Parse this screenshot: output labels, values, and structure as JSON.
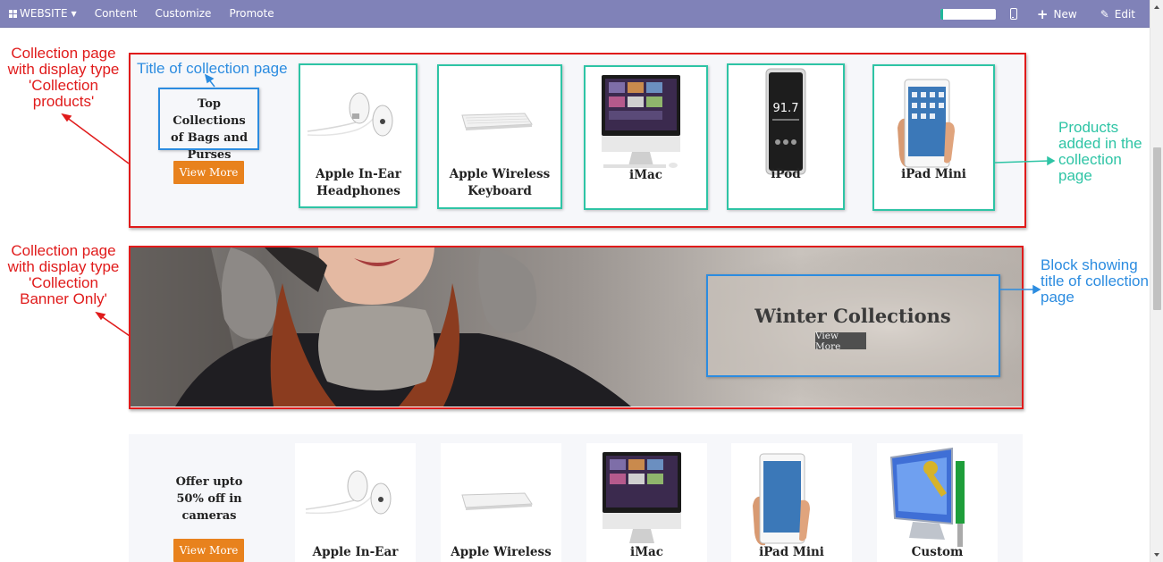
{
  "topbar": {
    "website_label": "WEBSITE",
    "menu": [
      "Content",
      "Customize",
      "Promote"
    ],
    "progress_fraction": 0.05,
    "new_label": "New",
    "edit_label": "Edit"
  },
  "colors": {
    "topbar": "#8082b8",
    "accent_button": "#e8821d",
    "annotation_red": "#e01b1b",
    "annotation_blue": "#2c8ce0",
    "annotation_green": "#2ec4a5"
  },
  "annotations": {
    "collection_products": "Collection page\nwith display type\n'Collection\nproducts'",
    "title_of_collection": "Title of collection page",
    "products_added": "Products\nadded in the\ncollection\npage",
    "collection_banner": "Collection page\nwith display type\n'Collection\nBanner Only'",
    "block_title": "Block showing\ntitle of collection\npage"
  },
  "collection_1": {
    "title": "Top Collections\nof Bags and\nPurses",
    "button": "View More",
    "products": [
      {
        "name": "Apple In-Ear\nHeadphones",
        "icon": "earphones-image"
      },
      {
        "name": "Apple Wireless\nKeyboard",
        "icon": "keyboard-image"
      },
      {
        "name": "iMac",
        "icon": "imac-image"
      },
      {
        "name": "iPod",
        "icon": "ipod-image"
      },
      {
        "name": "iPad Mini",
        "icon": "ipad-image"
      }
    ]
  },
  "banner": {
    "title": "Winter Collections",
    "button": "View More"
  },
  "collection_3": {
    "title": "Offer upto\n50% off in\ncameras",
    "button": "View More",
    "products": [
      {
        "name": "Apple In-Ear",
        "icon": "earphones-image"
      },
      {
        "name": "Apple Wireless",
        "icon": "keyboard-image"
      },
      {
        "name": "iMac",
        "icon": "imac-image"
      },
      {
        "name": "iPad Mini",
        "icon": "ipad-image"
      },
      {
        "name": "Custom",
        "icon": "tools-monitor-image"
      }
    ]
  }
}
